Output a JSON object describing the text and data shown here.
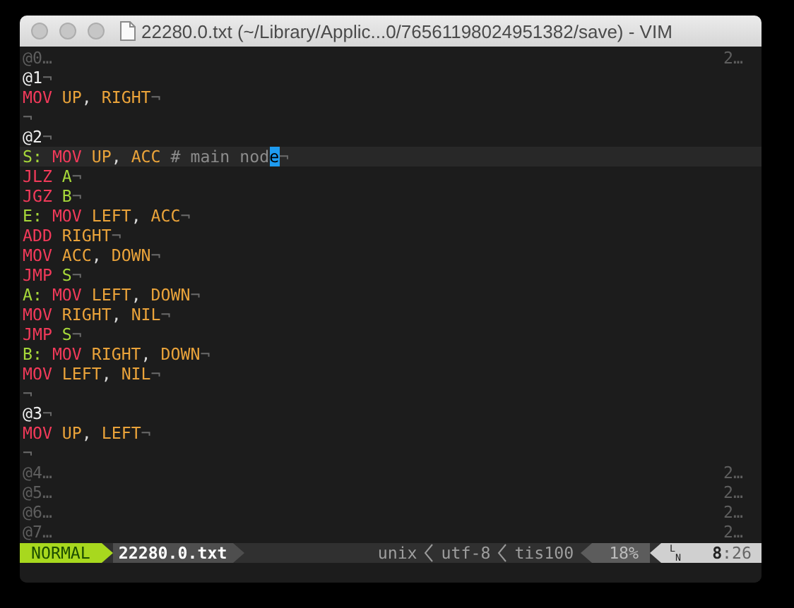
{
  "window": {
    "title": "22280.0.txt (~/Library/Applic...0/76561198024951382/save) - VIM"
  },
  "buffer": [
    {
      "kind": "fold",
      "text": "@0…",
      "count": "2…"
    },
    {
      "kind": "header",
      "text": "@1",
      "eol": "¬"
    },
    {
      "kind": "code",
      "current": false,
      "eol": "¬",
      "tokens": [
        {
          "kind": "op",
          "text": "MOV"
        },
        {
          "kind": "arg",
          "text": " UP"
        },
        {
          "kind": "punct",
          "text": ", "
        },
        {
          "kind": "arg",
          "text": "RIGHT"
        }
      ]
    },
    {
      "kind": "blank",
      "eol": "¬"
    },
    {
      "kind": "header",
      "text": "@2",
      "eol": "¬"
    },
    {
      "kind": "code",
      "current": true,
      "eol": "¬",
      "tokens": [
        {
          "kind": "label",
          "text": "S: "
        },
        {
          "kind": "op",
          "text": "MOV"
        },
        {
          "kind": "arg",
          "text": " UP"
        },
        {
          "kind": "punct",
          "text": ", "
        },
        {
          "kind": "arg",
          "text": "ACC"
        },
        {
          "kind": "comment",
          "text": " # main nod"
        },
        {
          "kind": "cursor",
          "text": "e"
        }
      ]
    },
    {
      "kind": "code",
      "current": false,
      "eol": "¬",
      "tokens": [
        {
          "kind": "op",
          "text": "JLZ"
        },
        {
          "kind": "label",
          "text": " A"
        }
      ]
    },
    {
      "kind": "code",
      "current": false,
      "eol": "¬",
      "tokens": [
        {
          "kind": "op",
          "text": "JGZ"
        },
        {
          "kind": "label",
          "text": " B"
        }
      ]
    },
    {
      "kind": "code",
      "current": false,
      "eol": "¬",
      "tokens": [
        {
          "kind": "label",
          "text": "E: "
        },
        {
          "kind": "op",
          "text": "MOV"
        },
        {
          "kind": "arg",
          "text": " LEFT"
        },
        {
          "kind": "punct",
          "text": ", "
        },
        {
          "kind": "arg",
          "text": "ACC"
        }
      ]
    },
    {
      "kind": "code",
      "current": false,
      "eol": "¬",
      "tokens": [
        {
          "kind": "op",
          "text": "ADD"
        },
        {
          "kind": "arg",
          "text": " RIGHT"
        }
      ]
    },
    {
      "kind": "code",
      "current": false,
      "eol": "¬",
      "tokens": [
        {
          "kind": "op",
          "text": "MOV"
        },
        {
          "kind": "arg",
          "text": " ACC"
        },
        {
          "kind": "punct",
          "text": ", "
        },
        {
          "kind": "arg",
          "text": "DOWN"
        }
      ]
    },
    {
      "kind": "code",
      "current": false,
      "eol": "¬",
      "tokens": [
        {
          "kind": "op",
          "text": "JMP"
        },
        {
          "kind": "label",
          "text": " S"
        }
      ]
    },
    {
      "kind": "code",
      "current": false,
      "eol": "¬",
      "tokens": [
        {
          "kind": "label",
          "text": "A: "
        },
        {
          "kind": "op",
          "text": "MOV"
        },
        {
          "kind": "arg",
          "text": " LEFT"
        },
        {
          "kind": "punct",
          "text": ", "
        },
        {
          "kind": "arg",
          "text": "DOWN"
        }
      ]
    },
    {
      "kind": "code",
      "current": false,
      "eol": "¬",
      "tokens": [
        {
          "kind": "op",
          "text": "MOV"
        },
        {
          "kind": "arg",
          "text": " RIGHT"
        },
        {
          "kind": "punct",
          "text": ", "
        },
        {
          "kind": "arg",
          "text": "NIL"
        }
      ]
    },
    {
      "kind": "code",
      "current": false,
      "eol": "¬",
      "tokens": [
        {
          "kind": "op",
          "text": "JMP"
        },
        {
          "kind": "label",
          "text": " S"
        }
      ]
    },
    {
      "kind": "code",
      "current": false,
      "eol": "¬",
      "tokens": [
        {
          "kind": "label",
          "text": "B: "
        },
        {
          "kind": "op",
          "text": "MOV"
        },
        {
          "kind": "arg",
          "text": " RIGHT"
        },
        {
          "kind": "punct",
          "text": ", "
        },
        {
          "kind": "arg",
          "text": "DOWN"
        }
      ]
    },
    {
      "kind": "code",
      "current": false,
      "eol": "¬",
      "tokens": [
        {
          "kind": "op",
          "text": "MOV"
        },
        {
          "kind": "arg",
          "text": " LEFT"
        },
        {
          "kind": "punct",
          "text": ", "
        },
        {
          "kind": "arg",
          "text": "NIL"
        }
      ]
    },
    {
      "kind": "blank",
      "eol": "¬"
    },
    {
      "kind": "header",
      "text": "@3",
      "eol": "¬"
    },
    {
      "kind": "code",
      "current": false,
      "eol": "¬",
      "tokens": [
        {
          "kind": "op",
          "text": "MOV"
        },
        {
          "kind": "arg",
          "text": " UP"
        },
        {
          "kind": "punct",
          "text": ", "
        },
        {
          "kind": "arg",
          "text": "LEFT"
        }
      ]
    },
    {
      "kind": "blank",
      "eol": "¬"
    },
    {
      "kind": "fold",
      "text": "@4…",
      "count": "2…"
    },
    {
      "kind": "fold",
      "text": "@5…",
      "count": "2…"
    },
    {
      "kind": "fold",
      "text": "@6…",
      "count": "2…"
    },
    {
      "kind": "fold",
      "text": "@7…",
      "count": "2…"
    }
  ],
  "status_bar": {
    "mode": "NORMAL",
    "filename": "22280.0.txt",
    "fileformat": "unix",
    "encoding": "utf-8",
    "filetype": "tis100",
    "percent": "18%",
    "line_symbol": "$^{L}$$_{N}$",
    "position": "**8**:26"
  }
}
